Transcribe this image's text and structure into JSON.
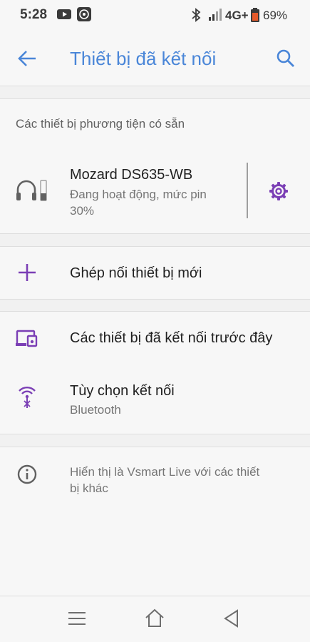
{
  "status": {
    "time": "5:28",
    "network": "4G+",
    "battery": "69%"
  },
  "appbar": {
    "title": "Thiết bị đã kết nối"
  },
  "media": {
    "section_title": "Các thiết bị phương tiện có sẵn",
    "device_name": "Mozard DS635-WB",
    "device_status_line1": "Đang hoạt động, mức pin",
    "device_status_line2": "30%"
  },
  "actions": {
    "pair_new": "Ghép nối thiết bị mới",
    "previously_connected": "Các thiết bị đã kết nối trước đây",
    "connection_prefs": "Tùy chọn kết nối",
    "connection_prefs_sub": "Bluetooth"
  },
  "info": {
    "line1": "Hiển thị là Vsmart Live với các thiết",
    "line2": "bị khác"
  },
  "colors": {
    "accent": "#4a86d8",
    "icon_purple": "#7b3fb5"
  }
}
